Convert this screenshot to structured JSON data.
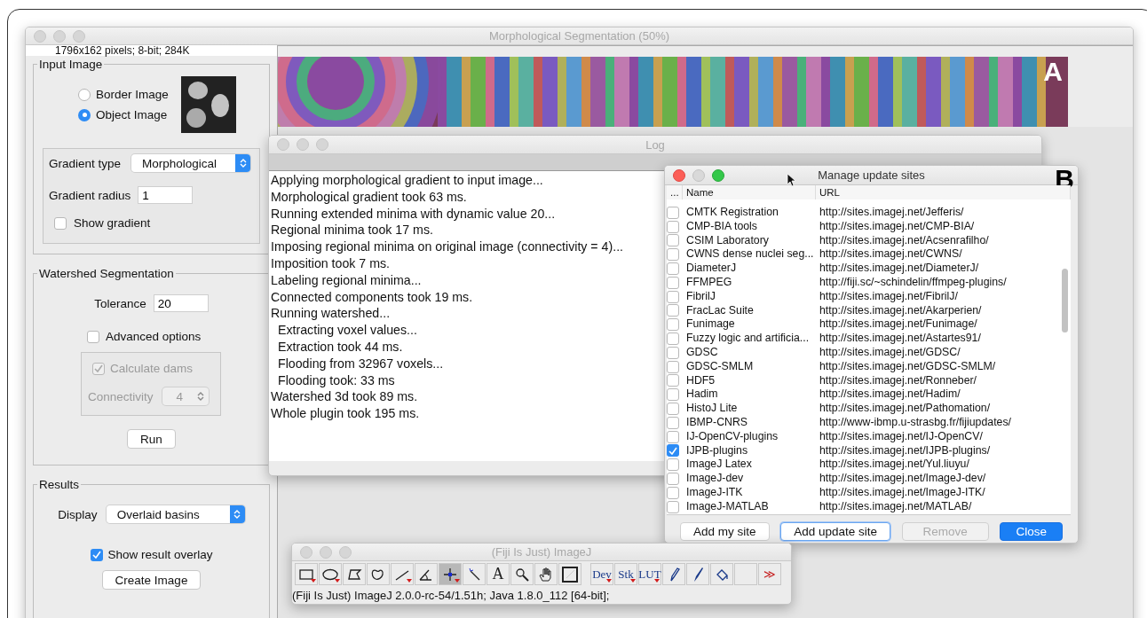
{
  "main_window": {
    "title": "Morphological Segmentation (50%)",
    "active": false,
    "image_info": "1796x162 pixels; 8-bit; 284K",
    "panel_label": "A",
    "input_image": {
      "legend": "Input Image",
      "options": [
        {
          "label": "Border Image",
          "selected": false
        },
        {
          "label": "Object Image",
          "selected": true
        }
      ],
      "gradient_type_label": "Gradient type",
      "gradient_type": "Morphological",
      "gradient_radius_label": "Gradient radius",
      "gradient_radius": "1",
      "show_gradient": {
        "label": "Show gradient",
        "checked": false
      }
    },
    "watershed": {
      "legend": "Watershed Segmentation",
      "tolerance_label": "Tolerance",
      "tolerance": "20",
      "advanced": {
        "label": "Advanced options",
        "checked": false
      },
      "calculate_dams": {
        "label": "Calculate dams",
        "checked": true,
        "disabled": true
      },
      "connectivity_label": "Connectivity",
      "connectivity": "4",
      "connectivity_disabled": true,
      "run": "Run"
    },
    "results": {
      "legend": "Results",
      "display_label": "Display",
      "display": "Overlaid basins",
      "show_overlay": {
        "label": "Show result overlay",
        "checked": true
      },
      "create": "Create Image"
    }
  },
  "log_window": {
    "title": "Log",
    "active": false,
    "lines": [
      {
        "text": "Applying morphological gradient to input image...",
        "indented": false
      },
      {
        "text": "Morphological gradient took 63 ms.",
        "indented": false
      },
      {
        "text": "Running extended minima with dynamic value 20...",
        "indented": false
      },
      {
        "text": "Regional minima took 17 ms.",
        "indented": false
      },
      {
        "text": "Imposing regional minima on original image (connectivity = 4)...",
        "indented": false
      },
      {
        "text": "Imposition took 7 ms.",
        "indented": false
      },
      {
        "text": "Labeling regional minima...",
        "indented": false
      },
      {
        "text": "Connected components took 19 ms.",
        "indented": false
      },
      {
        "text": "Running watershed...",
        "indented": false
      },
      {
        "text": "Extracting voxel values...",
        "indented": true
      },
      {
        "text": "Extraction took 44 ms.",
        "indented": true
      },
      {
        "text": "Flooding from 32967 voxels...",
        "indented": true
      },
      {
        "text": "Flooding took: 33 ms",
        "indented": true
      },
      {
        "text": "Watershed 3d took 89 ms.",
        "indented": false
      },
      {
        "text": "Whole plugin took 195 ms.",
        "indented": false
      }
    ]
  },
  "update_sites": {
    "title": "Manage update sites",
    "active": true,
    "panel_label": "B",
    "columns": [
      "...",
      "Name",
      "URL"
    ],
    "rows": [
      {
        "name": "CMTK Registration",
        "url": "http://sites.imagej.net/Jefferis/",
        "checked": false
      },
      {
        "name": "CMP-BIA tools",
        "url": "http://sites.imagej.net/CMP-BIA/",
        "checked": false
      },
      {
        "name": "CSIM Laboratory",
        "url": "http://sites.imagej.net/Acsenrafilho/",
        "checked": false
      },
      {
        "name": "CWNS dense nuclei seg...",
        "url": "http://sites.imagej.net/CWNS/",
        "checked": false
      },
      {
        "name": "DiameterJ",
        "url": "http://sites.imagej.net/DiameterJ/",
        "checked": false
      },
      {
        "name": "FFMPEG",
        "url": "http://fiji.sc/~schindelin/ffmpeg-plugins/",
        "checked": false
      },
      {
        "name": "FibrilJ",
        "url": "http://sites.imagej.net/FibrilJ/",
        "checked": false
      },
      {
        "name": "FracLac Suite",
        "url": "http://sites.imagej.net/Akarperien/",
        "checked": false
      },
      {
        "name": "Funimage",
        "url": "http://sites.imagej.net/Funimage/",
        "checked": false
      },
      {
        "name": "Fuzzy logic and artificia...",
        "url": "http://sites.imagej.net/Astartes91/",
        "checked": false
      },
      {
        "name": "GDSC",
        "url": "http://sites.imagej.net/GDSC/",
        "checked": false
      },
      {
        "name": "GDSC-SMLM",
        "url": "http://sites.imagej.net/GDSC-SMLM/",
        "checked": false
      },
      {
        "name": "HDF5",
        "url": "http://sites.imagej.net/Ronneber/",
        "checked": false
      },
      {
        "name": "Hadim",
        "url": "http://sites.imagej.net/Hadim/",
        "checked": false
      },
      {
        "name": "HistoJ Lite",
        "url": "http://sites.imagej.net/Pathomation/",
        "checked": false
      },
      {
        "name": "IBMP-CNRS",
        "url": "http://www-ibmp.u-strasbg.fr/fijiupdates/",
        "checked": false
      },
      {
        "name": "IJ-OpenCV-plugins",
        "url": "http://sites.imagej.net/IJ-OpenCV/",
        "checked": false
      },
      {
        "name": "IJPB-plugins",
        "url": "http://sites.imagej.net/IJPB-plugins/",
        "checked": true
      },
      {
        "name": "ImageJ Latex",
        "url": "http://sites.imagej.net/Yul.liuyu/",
        "checked": false
      },
      {
        "name": "ImageJ-dev",
        "url": "http://sites.imagej.net/ImageJ-dev/",
        "checked": false
      },
      {
        "name": "ImageJ-ITK",
        "url": "http://sites.imagej.net/ImageJ-ITK/",
        "checked": false
      },
      {
        "name": "ImageJ-MATLAB",
        "url": "http://sites.imagej.net/MATLAB/",
        "checked": false
      }
    ],
    "buttons": [
      {
        "label": "Add my site",
        "kind": "default"
      },
      {
        "label": "Add update site",
        "kind": "focused"
      },
      {
        "label": "Remove",
        "kind": "disabled"
      },
      {
        "label": "Close",
        "kind": "primary"
      }
    ]
  },
  "imagej_window": {
    "title": "(Fiji Is Just) ImageJ",
    "active": false,
    "tools": [
      {
        "kind": "rectangle",
        "has_menu": true,
        "selected": false
      },
      {
        "kind": "oval",
        "has_menu": true,
        "selected": false
      },
      {
        "kind": "polygon",
        "has_menu": false,
        "selected": false
      },
      {
        "kind": "freehand",
        "has_menu": false,
        "selected": false
      },
      {
        "kind": "line",
        "has_menu": true,
        "selected": false
      },
      {
        "kind": "angle",
        "has_menu": false,
        "selected": false
      },
      {
        "kind": "point",
        "has_menu": true,
        "selected": true
      },
      {
        "kind": "wand",
        "has_menu": false,
        "selected": false
      },
      {
        "kind": "text",
        "label": "A",
        "has_menu": false,
        "selected": false
      },
      {
        "kind": "magnifier",
        "has_menu": false,
        "selected": false
      },
      {
        "kind": "hand",
        "has_menu": false,
        "selected": false
      },
      {
        "kind": "dropper",
        "has_menu": false,
        "selected": false
      },
      {
        "kind": "gap"
      },
      {
        "kind": "menu",
        "label": "Dev",
        "has_menu": true,
        "selected": false
      },
      {
        "kind": "menu",
        "label": "Stk",
        "has_menu": true,
        "selected": false
      },
      {
        "kind": "menu",
        "label": "LUT",
        "has_menu": true,
        "selected": false
      },
      {
        "kind": "pencil",
        "has_menu": false,
        "selected": false
      },
      {
        "kind": "brush",
        "has_menu": false,
        "selected": false
      },
      {
        "kind": "fill",
        "has_menu": false,
        "selected": false
      },
      {
        "kind": "empty",
        "has_menu": false,
        "selected": false
      },
      {
        "kind": "more",
        "label": "≫",
        "has_menu": false,
        "selected": false
      }
    ],
    "status": "(Fiji Is Just) ImageJ 2.0.0-rc-54/1.51h; Java 1.8.0_112 [64-bit];"
  }
}
